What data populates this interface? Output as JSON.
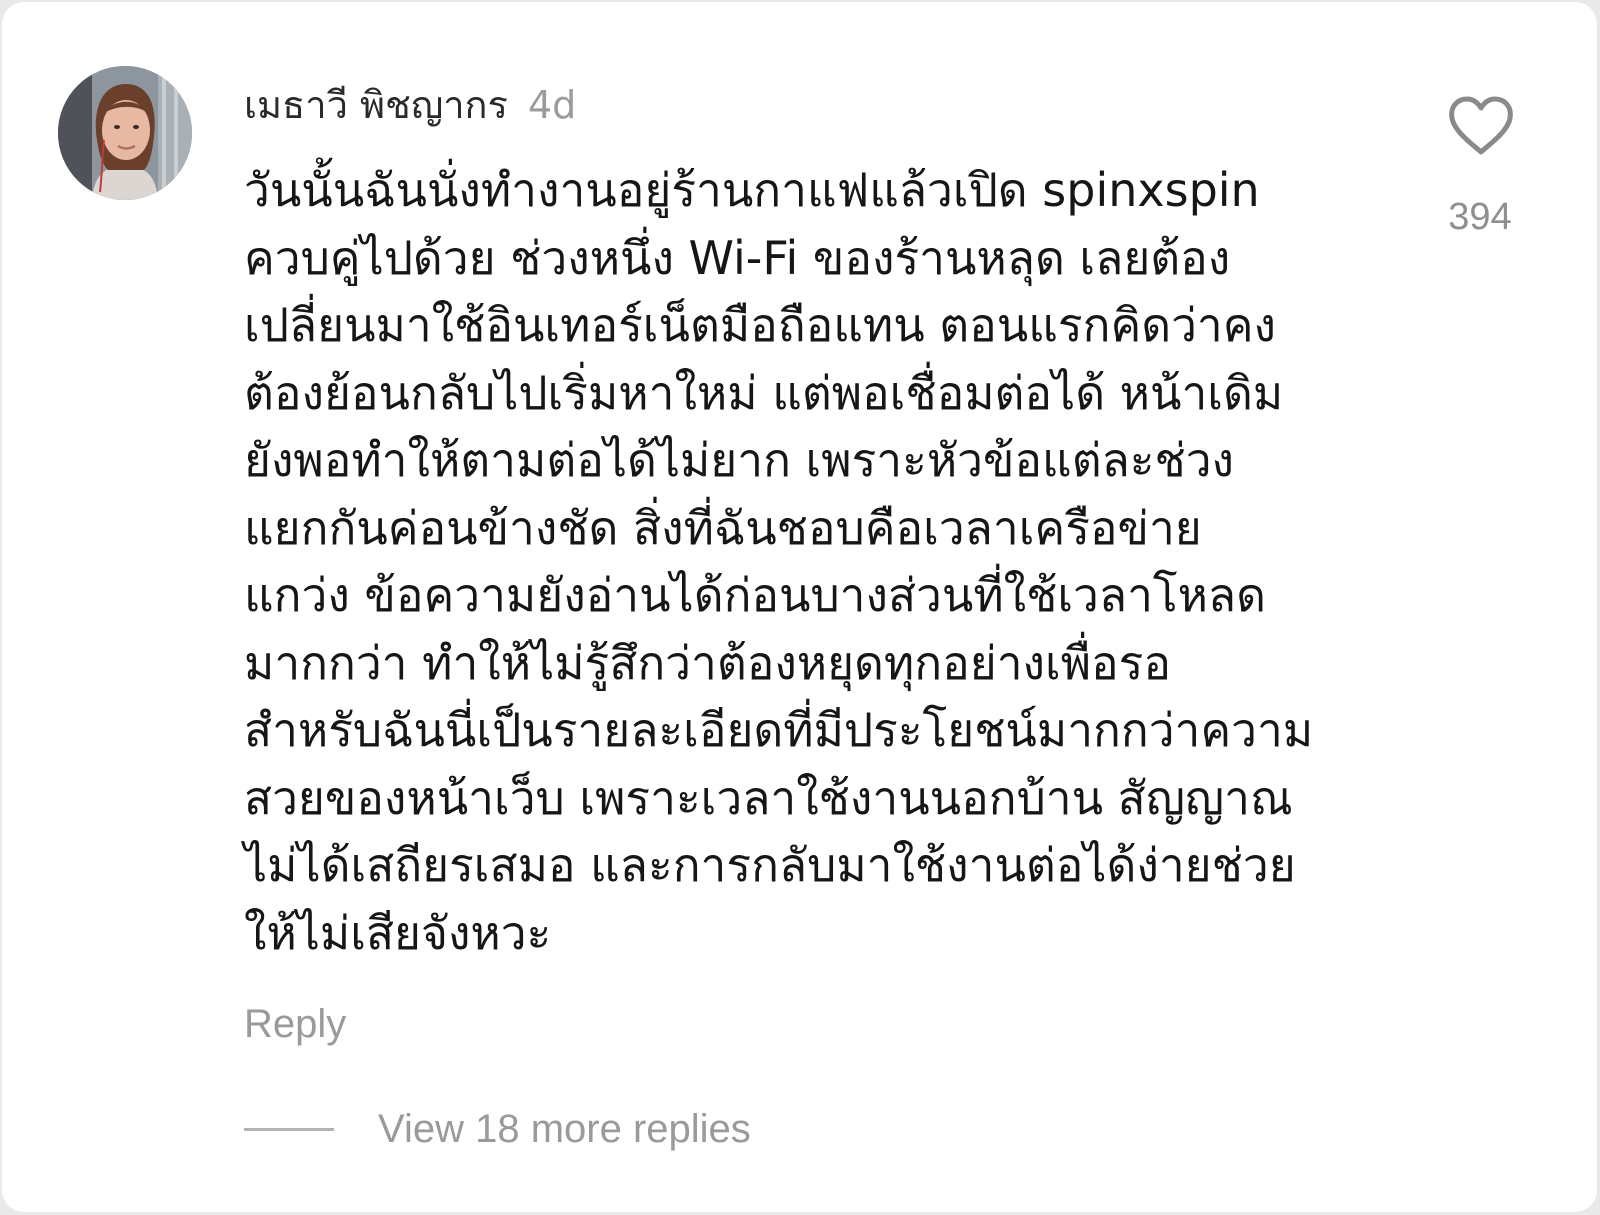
{
  "comment": {
    "author_name": "เมธาวี พิชญากร",
    "timestamp": "4d",
    "body_lines": [
      "วันนั้นฉันนั่งทำงานอยู่ร้านกาแฟแล้วเปิด spinxspin",
      "ควบคู่ไปด้วย ช่วงหนึ่ง Wi-Fi ของร้านหลุด เลยต้อง",
      "เปลี่ยนมาใช้อินเทอร์เน็ตมือถือแทน ตอนแรกคิดว่าคง",
      "ต้องย้อนกลับไปเริ่มหาใหม่ แต่พอเชื่อมต่อได้ หน้าเดิม",
      "ยังพอทำให้ตามต่อได้ไม่ยาก เพราะหัวข้อแต่ละช่วง",
      "แยกกันค่อนข้างชัด สิ่งที่ฉันชอบคือเวลาเครือข่าย",
      "แกว่ง ข้อความยังอ่านได้ก่อนบางส่วนที่ใช้เวลาโหลด",
      "มากกว่า ทำให้ไม่รู้สึกว่าต้องหยุดทุกอย่างเพื่อรอ",
      "สำหรับฉันนี่เป็นรายละเอียดที่มีประโยชน์มากกว่าความ",
      "สวยของหน้าเว็บ เพราะเวลาใช้งานนอกบ้าน สัญญาณ",
      "ไม่ได้เสถียรเสมอ และการกลับมาใช้งานต่อได้ง่ายช่วย",
      "ให้ไม่เสียจังหวะ"
    ],
    "like_count": "394",
    "like_icon": "heart-outline-icon",
    "reply_label": "Reply",
    "view_replies_label": "View 18 more replies"
  },
  "colors": {
    "background": "#ffffff",
    "author_text": "#2a2a2a",
    "body_text": "#161616",
    "secondary_text": "#9a9a9a",
    "icon_stroke": "#8a8a8a"
  }
}
